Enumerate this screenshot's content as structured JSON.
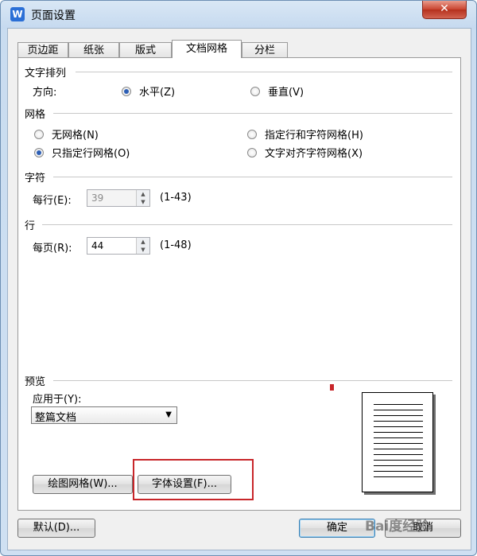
{
  "window": {
    "title": "页面设置",
    "app_icon": "W",
    "close_symbol": "✕"
  },
  "tabs": [
    "页边距",
    "纸张",
    "版式",
    "文档网格",
    "分栏"
  ],
  "active_tab": "文档网格",
  "text_direction": {
    "heading": "文字排列",
    "label": "方向:",
    "options": [
      "水平(Z)",
      "垂直(V)"
    ],
    "selected": "水平(Z)"
  },
  "grid": {
    "heading": "网格",
    "options": [
      "无网格(N)",
      "指定行和字符网格(H)",
      "只指定行网格(O)",
      "文字对齐字符网格(X)"
    ],
    "selected": "只指定行网格(O)"
  },
  "chars": {
    "heading": "字符",
    "label": "每行(E):",
    "value": "39",
    "range": "(1-43)",
    "enabled": false
  },
  "lines": {
    "heading": "行",
    "label": "每页(R):",
    "value": "44",
    "range": "(1-48)"
  },
  "preview": {
    "heading": "预览",
    "apply_label": "应用于(Y):",
    "apply_value": "整篇文档"
  },
  "buttons": {
    "draw_grid": "绘图网格(W)...",
    "font_settings": "字体设置(F)...",
    "default": "默认(D)...",
    "ok": "确定",
    "cancel": "取消"
  },
  "watermark": "Bai度经验",
  "colors": {
    "highlight": "#c8262a",
    "radio_selected": "#2d5fb5",
    "title_bar": "#c9dcf0"
  }
}
